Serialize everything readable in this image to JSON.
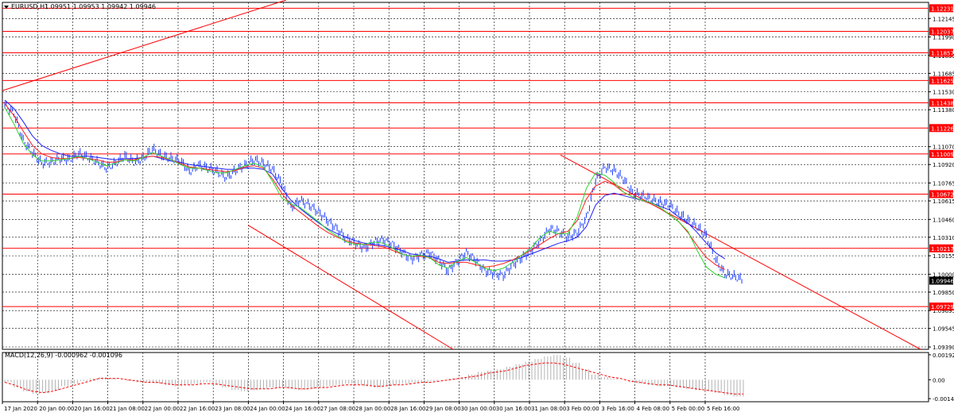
{
  "header": {
    "symbol_title": "EURUSD,H1",
    "ohlc": "1.09951 1.09953 1.09942 1.09946",
    "menu_icon": "triangle-down-icon"
  },
  "macd": {
    "title": "MACD(12,26,9) -0.000962 -0.001096"
  },
  "colors": {
    "background": "#ffffff",
    "grid": "#000000",
    "candle": "#1a3cff",
    "level": "#ff0000",
    "level_label_bg": "#ff0000",
    "price_tag_bg": "#000000",
    "ma_fast": "#2fd32f",
    "ma_mid": "#ff2020",
    "ma_slow": "#2020ff"
  },
  "chart_data": [
    {
      "type": "candlestick",
      "title": "EURUSD,H1",
      "ylim": [
        1.0937,
        1.1228
      ],
      "yticks": [
        "1.12145",
        "1.11990",
        "1.11835",
        "1.11685",
        "1.11530",
        "1.11380",
        "1.11070",
        "1.10920",
        "1.10765",
        "1.10615",
        "1.10460",
        "1.10310",
        "1.10155",
        "1.10000",
        "1.09850",
        "1.09695",
        "1.09545",
        "1.09390"
      ],
      "ytick_values": [
        1.12145,
        1.1199,
        1.11835,
        1.11685,
        1.1153,
        1.1138,
        1.1107,
        1.1092,
        1.10765,
        1.10615,
        1.1046,
        1.1031,
        1.10155,
        1.1,
        1.0985,
        1.09695,
        1.09545,
        1.0939
      ],
      "levels": [
        {
          "label": "1.12231",
          "value": 1.12231
        },
        {
          "label": "1.12037",
          "value": 1.12037
        },
        {
          "label": "1.11857",
          "value": 1.11857
        },
        {
          "label": "1.11625",
          "value": 1.11625
        },
        {
          "label": "1.11438",
          "value": 1.11438
        },
        {
          "label": "1.11226",
          "value": 1.11226
        },
        {
          "label": "1.11009",
          "value": 1.11009
        },
        {
          "label": "1.10672",
          "value": 1.10672
        },
        {
          "label": "1.10217",
          "value": 1.10217
        },
        {
          "label": "1.09729",
          "value": 1.09729
        }
      ],
      "current_price": {
        "label": "1.09946",
        "value": 1.09946
      },
      "xticks": [
        "17 Jan 2020",
        "20 Jan 00:00",
        "20 Jan 16:00",
        "21 Jan 08:00",
        "22 Jan 00:00",
        "22 Jan 16:00",
        "23 Jan 08:00",
        "24 Jan 00:00",
        "24 Jan 16:00",
        "27 Jan 08:00",
        "28 Jan 00:00",
        "28 Jan 16:00",
        "29 Jan 08:00",
        "30 Jan 00:00",
        "30 Jan 16:00",
        "31 Jan 08:00",
        "3 Feb 00:00",
        "3 Feb 16:00",
        "4 Feb 08:00",
        "5 Feb 00:00",
        "5 Feb 16:00"
      ],
      "closes": [
        1.1142,
        1.1135,
        1.1112,
        1.1102,
        1.1093,
        1.1094,
        1.1097,
        1.1096,
        1.1101,
        1.1098,
        1.1094,
        1.1089,
        1.1093,
        1.1099,
        1.1094,
        1.1097,
        1.1105,
        1.1099,
        1.1097,
        1.1095,
        1.1086,
        1.1091,
        1.1089,
        1.1086,
        1.1081,
        1.1087,
        1.1091,
        1.1096,
        1.1093,
        1.1088,
        1.1076,
        1.1056,
        1.1062,
        1.1058,
        1.1052,
        1.1045,
        1.1038,
        1.103,
        1.1026,
        1.1022,
        1.1027,
        1.1029,
        1.1025,
        1.1019,
        1.1013,
        1.1016,
        1.1018,
        1.1012,
        1.1003,
        1.1011,
        1.1018,
        1.1012,
        1.1003,
        1.1001,
        1.0999,
        1.1008,
        1.1014,
        1.102,
        1.1028,
        1.1038,
        1.1036,
        1.1031,
        1.1035,
        1.1047,
        1.1079,
        1.109,
        1.1087,
        1.108,
        1.1068,
        1.1066,
        1.1063,
        1.106,
        1.1058,
        1.1051,
        1.1045,
        1.104,
        1.1032,
        1.1012,
        1.1,
        1.0998,
        1.0995
      ],
      "ma_slow": [
        1.1146,
        1.1139,
        1.1128,
        1.1116,
        1.1108,
        1.1104,
        1.1101,
        1.1099,
        1.1099,
        1.1099,
        1.1098,
        1.1097,
        1.1096,
        1.1097,
        1.1097,
        1.1098,
        1.1099,
        1.1097,
        1.1095,
        1.1094,
        1.1092,
        1.1091,
        1.109,
        1.1089,
        1.1088,
        1.1088,
        1.1089,
        1.1089,
        1.1088,
        1.1084,
        1.1072,
        1.1062,
        1.1055,
        1.1049,
        1.1043,
        1.1038,
        1.1034,
        1.1031,
        1.1028,
        1.1026,
        1.1025,
        1.1024,
        1.1022,
        1.102,
        1.1017,
        1.1016,
        1.1015,
        1.1013,
        1.101,
        1.1011,
        1.1012,
        1.1012,
        1.1012,
        1.1011,
        1.1011,
        1.1012,
        1.1014,
        1.1017,
        1.102,
        1.1023,
        1.1026,
        1.1028,
        1.1031,
        1.104,
        1.1058,
        1.1066,
        1.1068,
        1.1066,
        1.1064,
        1.1062,
        1.106,
        1.1057,
        1.1054,
        1.1048,
        1.1043,
        1.1035,
        1.1026,
        1.1018,
        1.1013
      ],
      "ma_mid": [
        1.1143,
        1.1133,
        1.112,
        1.1108,
        1.1101,
        1.1098,
        1.1097,
        1.1097,
        1.1098,
        1.1097,
        1.1096,
        1.1094,
        1.1094,
        1.1096,
        1.1096,
        1.1098,
        1.1099,
        1.1098,
        1.1096,
        1.1093,
        1.109,
        1.1089,
        1.1088,
        1.1087,
        1.1086,
        1.1087,
        1.109,
        1.1091,
        1.1089,
        1.108,
        1.1068,
        1.1058,
        1.1052,
        1.1046,
        1.104,
        1.1035,
        1.1031,
        1.1028,
        1.1026,
        1.1025,
        1.1024,
        1.1023,
        1.102,
        1.1017,
        1.1015,
        1.1015,
        1.1014,
        1.101,
        1.1009,
        1.101,
        1.101,
        1.1008,
        1.1006,
        1.1007,
        1.1009,
        1.1012,
        1.1016,
        1.102,
        1.1025,
        1.103,
        1.1034,
        1.1036,
        1.1045,
        1.1063,
        1.1074,
        1.1078,
        1.1075,
        1.1069,
        1.1065,
        1.1062,
        1.1059,
        1.1055,
        1.105,
        1.1044,
        1.1035,
        1.1024,
        1.1014,
        1.1008,
        1.1004
      ],
      "ma_fast": [
        1.114,
        1.1126,
        1.111,
        1.11,
        1.1095,
        1.1095,
        1.1096,
        1.1097,
        1.1099,
        1.1097,
        1.1094,
        1.1091,
        1.1093,
        1.1096,
        1.1095,
        1.1098,
        1.1102,
        1.1099,
        1.1096,
        1.1092,
        1.1089,
        1.1089,
        1.1087,
        1.1085,
        1.1085,
        1.1088,
        1.1091,
        1.1093,
        1.109,
        1.1078,
        1.1064,
        1.1059,
        1.1056,
        1.105,
        1.1044,
        1.1037,
        1.1032,
        1.1027,
        1.1025,
        1.1025,
        1.1027,
        1.1026,
        1.1022,
        1.1017,
        1.1015,
        1.1016,
        1.1014,
        1.1008,
        1.1005,
        1.1011,
        1.1014,
        1.101,
        1.1005,
        1.1003,
        1.1005,
        1.101,
        1.1016,
        1.1022,
        1.1031,
        1.1036,
        1.1034,
        1.1034,
        1.1048,
        1.1072,
        1.1085,
        1.1083,
        1.1077,
        1.1069,
        1.1065,
        1.1062,
        1.106,
        1.1056,
        1.105,
        1.1044,
        1.1036,
        1.102,
        1.1006,
        1.1,
        1.0997
      ],
      "trendlines": [
        {
          "from": {
            "x": "17 Jan 2020",
            "y": 1.1154
          },
          "to": {
            "x": "24 Jan 00:00",
            "y": 1.123
          }
        },
        {
          "from": {
            "x": "24 Jan 00:00",
            "y": 1.1041
          },
          "to": {
            "x": "29 Jan 08:00",
            "y": 1.0937
          }
        },
        {
          "from": {
            "x": "31 Jan 08:00",
            "y": 1.11
          },
          "to": {
            "x": "chart end",
            "y": 1.0937
          }
        }
      ]
    },
    {
      "type": "histogram",
      "title": "MACD(12,26,9)",
      "yticks": [
        "0.001924",
        "0.00",
        "-0.00146"
      ],
      "ytick_values": [
        0.001924,
        0.0,
        -0.00146
      ],
      "ylim": [
        -0.0017,
        0.0021
      ],
      "histogram": [
        -0.0002,
        -0.0006,
        -0.0009,
        -0.0011,
        -0.001,
        -0.0008,
        -0.0005,
        -0.0003,
        -0.0001,
        0.0001,
        0.0002,
        0.0001,
        0.0,
        -0.0001,
        -0.0002,
        -0.0002,
        -0.0003,
        -0.0004,
        -0.0005,
        -0.0004,
        -0.0003,
        -0.0002,
        -0.0004,
        -0.0006,
        -0.0008,
        -0.0009,
        -0.0008,
        -0.0007,
        -0.0006,
        -0.0006,
        -0.0007,
        -0.0008,
        -0.0007,
        -0.0006,
        -0.0005,
        -0.0004,
        -0.0003,
        -0.0004,
        -0.0005,
        -0.0006,
        -0.0005,
        -0.0004,
        -0.0003,
        -0.0002,
        -0.0002,
        -0.0001,
        0.0,
        0.0001,
        0.0002,
        0.0004,
        0.0006,
        0.0007,
        0.0008,
        0.001,
        0.0012,
        0.0014,
        0.0016,
        0.0018,
        0.0019,
        0.0017,
        0.0013,
        0.0008,
        0.0004,
        0.0002,
        0.0001,
        0.0,
        -0.0002,
        -0.0003,
        -0.0004,
        -0.0005,
        -0.0005,
        -0.0006,
        -0.0007,
        -0.0008,
        -0.0009,
        -0.001,
        -0.0012,
        -0.0013,
        -0.0013
      ],
      "signal": [
        -0.0002,
        -0.0004,
        -0.0007,
        -0.0009,
        -0.001,
        -0.0009,
        -0.0007,
        -0.0005,
        -0.0003,
        -0.0001,
        0.0001,
        0.0001,
        0.0001,
        0.0,
        -0.0001,
        -0.0002,
        -0.0002,
        -0.0003,
        -0.0004,
        -0.0004,
        -0.0004,
        -0.0003,
        -0.0003,
        -0.0004,
        -0.0005,
        -0.0006,
        -0.0007,
        -0.0007,
        -0.0007,
        -0.0006,
        -0.0006,
        -0.0007,
        -0.0007,
        -0.0006,
        -0.0006,
        -0.0005,
        -0.0004,
        -0.0004,
        -0.0004,
        -0.0005,
        -0.0005,
        -0.0004,
        -0.0004,
        -0.0003,
        -0.0002,
        -0.0002,
        -0.0001,
        0.0,
        0.0001,
        0.0002,
        0.0003,
        0.0005,
        0.0006,
        0.0007,
        0.0009,
        0.0011,
        0.0012,
        0.0013,
        0.0013,
        0.0012,
        0.001,
        0.0008,
        0.0006,
        0.0004,
        0.0002,
        0.0001,
        -0.0001,
        -0.0002,
        -0.0003,
        -0.0004,
        -0.0004,
        -0.0005,
        -0.0006,
        -0.0007,
        -0.0008,
        -0.0009,
        -0.001,
        -0.0011,
        -0.0011
      ]
    }
  ]
}
